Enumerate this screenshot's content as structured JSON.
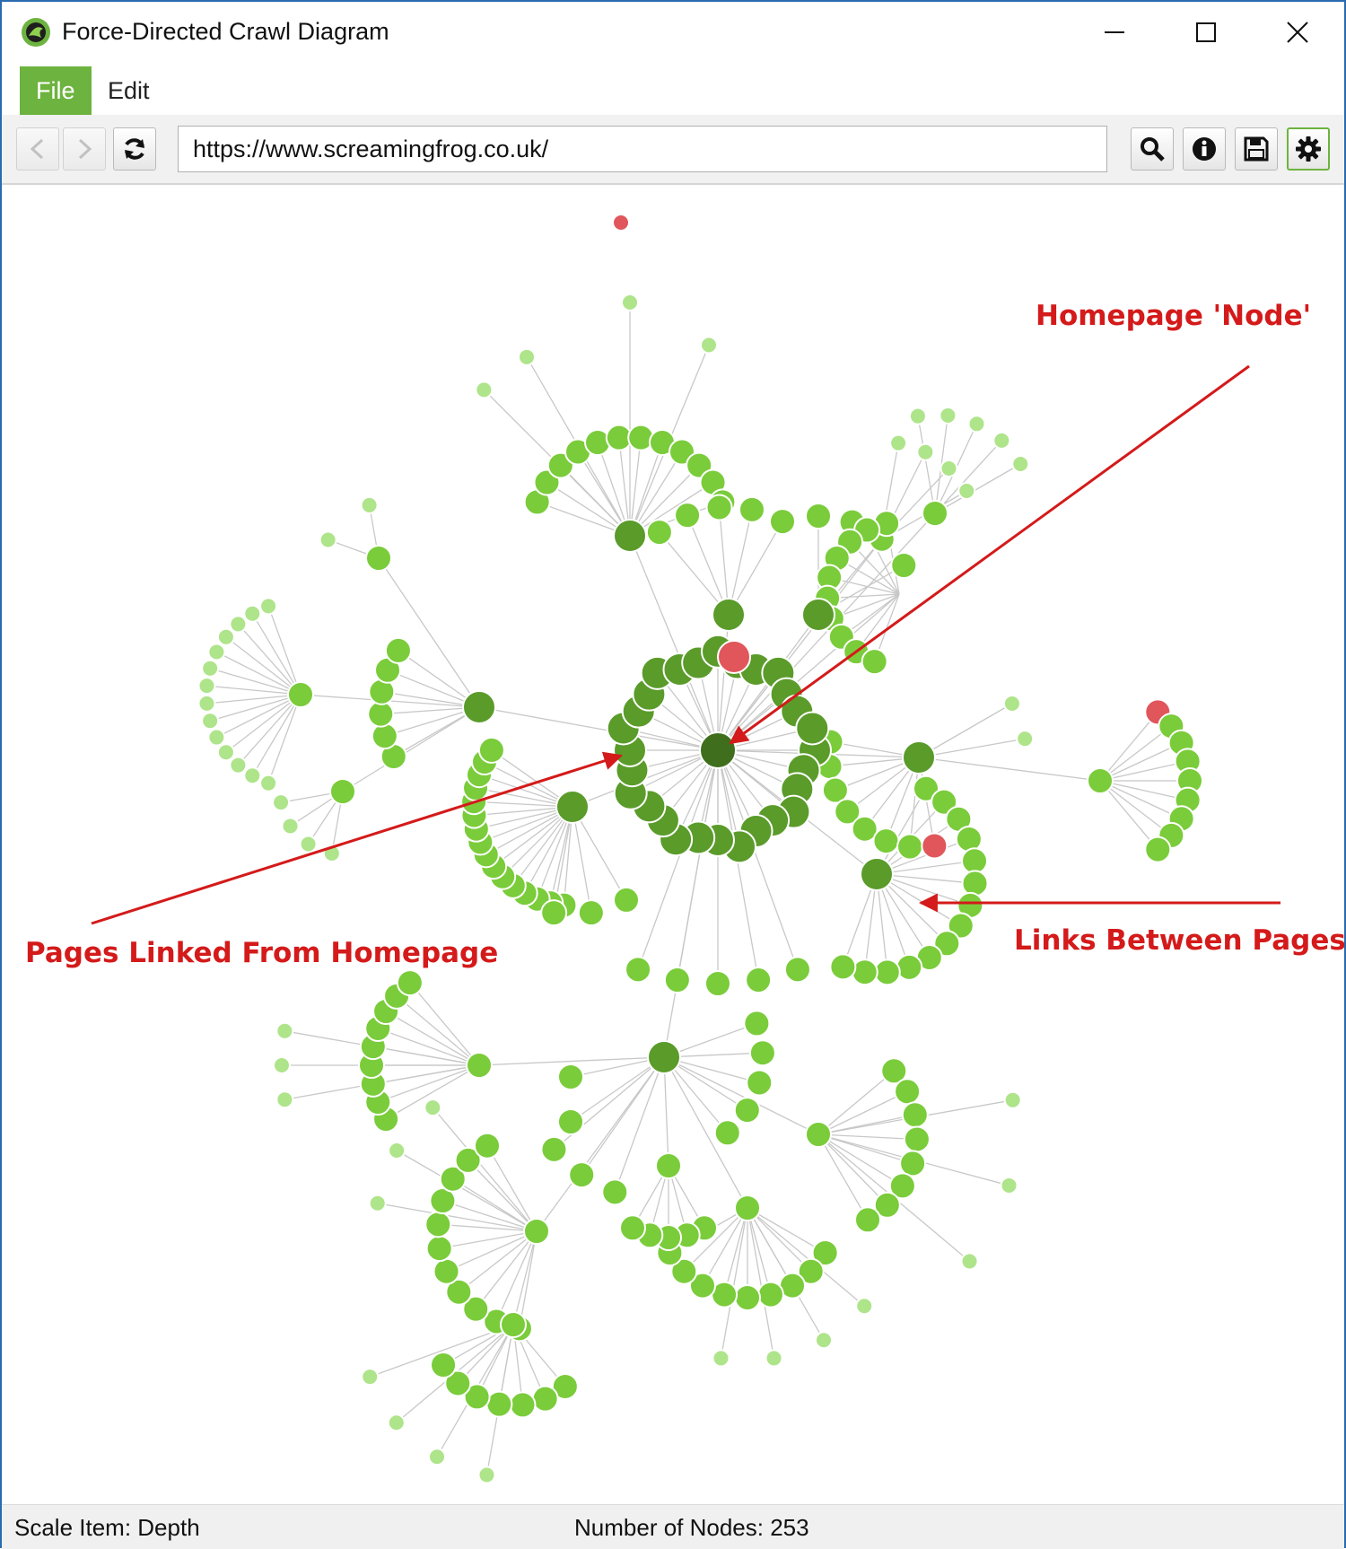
{
  "window": {
    "title": "Force-Directed Crawl Diagram"
  },
  "icons": {
    "app": "frog-logo-icon",
    "minimize": "minimize-icon",
    "maximize": "maximize-icon",
    "close": "close-icon",
    "back": "arrow-left-icon",
    "forward": "arrow-right-icon",
    "refresh": "refresh-icon",
    "search": "search-icon",
    "info": "info-icon",
    "save": "save-icon",
    "settings": "gear-icon"
  },
  "menu": {
    "file": "File",
    "edit": "Edit"
  },
  "toolbar": {
    "url": "https://www.screamingfrog.co.uk/"
  },
  "annotations": {
    "homepage_node": "Homepage 'Node'",
    "pages_linked": "Pages Linked From Homepage",
    "links_between": "Links Between Pages"
  },
  "status": {
    "scale_item": "Scale Item: Depth",
    "node_count": "Number of Nodes: 253"
  },
  "colors": {
    "brand_green": "#6db33f",
    "depth0": "#3f6f1d",
    "depth1": "#5a9b2a",
    "depth2": "#7acc3a",
    "depth3": "#aee48a",
    "non_indexable": "#e0565b",
    "annotation_red": "#d41a1a",
    "edge": "#c8c8c8"
  }
}
